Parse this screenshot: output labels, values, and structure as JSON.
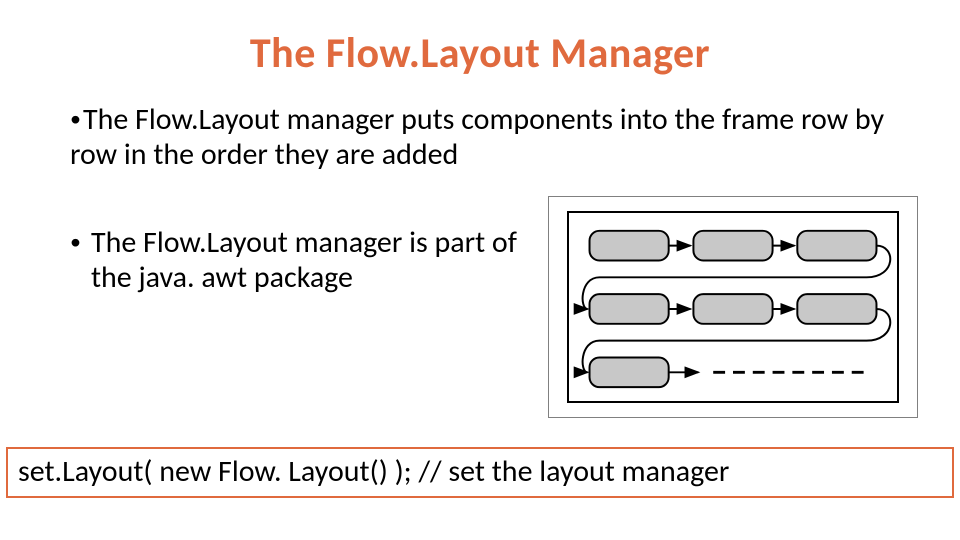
{
  "title": "The Flow.Layout Manager",
  "bullets": {
    "b1": "The Flow.Layout manager puts components into the frame row by row in the order they are added",
    "b2": "The Flow.Layout manager is part of the java. awt package"
  },
  "code_line": "set.Layout( new Flow. Layout() ); // set the layout manager",
  "colors": {
    "accent": "#e06a3e"
  },
  "diagram": {
    "name": "flow-layout-diagram",
    "rows": 3,
    "boxes_per_row": 3,
    "last_row_trailing_dashes": true
  }
}
